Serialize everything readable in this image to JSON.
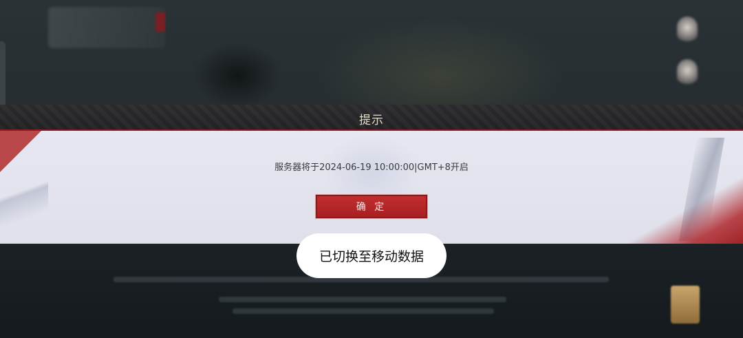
{
  "dialog": {
    "title": "提示",
    "message": "服务器将于2024-06-19 10:00:00|GMT+8开启",
    "confirm_label": "确 定"
  },
  "toast": {
    "text": "已切换至移动数据"
  },
  "colors": {
    "accent_red": "#b02a2d",
    "dialog_bg": "#e3e4ee",
    "title_text": "#e6dcc6"
  }
}
